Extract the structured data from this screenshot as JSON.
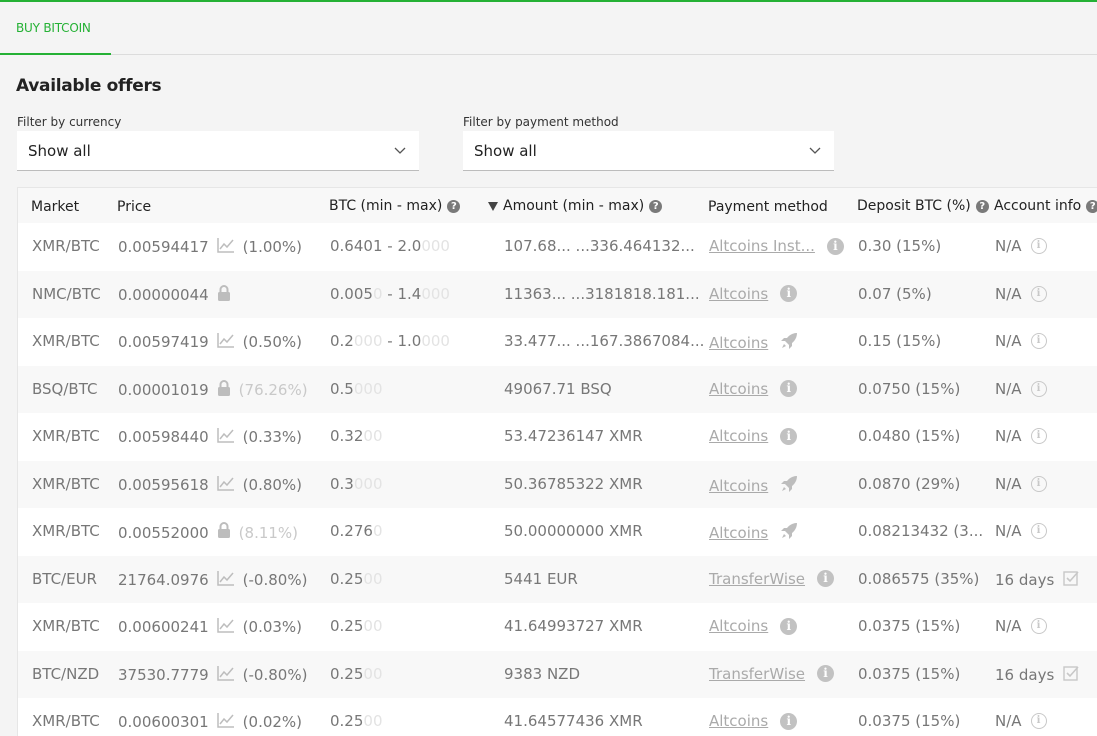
{
  "tabs": [
    {
      "label": "BUY BITCOIN",
      "active": true
    }
  ],
  "heading": "Available offers",
  "filters": {
    "currency": {
      "label": "Filter by currency",
      "value": "Show all"
    },
    "payment": {
      "label": "Filter by payment method",
      "value": "Show all"
    }
  },
  "columns": {
    "market": "Market",
    "price": "Price",
    "btc": "BTC (min - max)",
    "amount": "Amount (min - max)",
    "payment": "Payment method",
    "deposit": "Deposit BTC (%)",
    "account": "Account info"
  },
  "rows": [
    {
      "market": "XMR/BTC",
      "price": "0.00594417",
      "price_icon": "chart-icon",
      "pct": "(1.00%)",
      "pct_light": false,
      "btc_a": "0.6401",
      "btc_sep": " - ",
      "btc_b": "2.0",
      "btc_b_faint": "000",
      "amount": "107.68... ...336.464132...",
      "pay": "Altcoins Inst...",
      "pay_icon": "info-icon",
      "deposit": "0.30 (15%)",
      "account": "N/A",
      "account_icon": "info-circle-icon"
    },
    {
      "market": "NMC/BTC",
      "price": "0.00000044",
      "price_icon": "lock-icon",
      "pct": "",
      "pct_light": false,
      "btc_a": "0.005",
      "btc_a_faint": "0",
      "btc_sep": " - ",
      "btc_b": "1.4",
      "btc_b_faint": "000",
      "amount": "11363... ...3181818.181...",
      "pay": "Altcoins",
      "pay_icon": "info-icon",
      "deposit": "0.07 (5%)",
      "account": "N/A",
      "account_icon": "info-circle-icon"
    },
    {
      "market": "XMR/BTC",
      "price": "0.00597419",
      "price_icon": "chart-icon",
      "pct": "(0.50%)",
      "pct_light": false,
      "btc_a": "0.2",
      "btc_a_faint": "000",
      "btc_sep": " - ",
      "btc_b": "1.0",
      "btc_b_faint": "000",
      "amount": "33.477... ...167.3867084...",
      "pay": "Altcoins",
      "pay_icon": "rocket-icon",
      "deposit": "0.15 (15%)",
      "account": "N/A",
      "account_icon": "info-circle-icon"
    },
    {
      "market": "BSQ/BTC",
      "price": "0.00001019",
      "price_icon": "lock-icon",
      "pct": "(76.26%)",
      "pct_light": true,
      "btc_a": "0.5",
      "btc_a_faint": "000",
      "amount": "49067.71 BSQ",
      "pay": "Altcoins",
      "pay_icon": "info-icon",
      "deposit": "0.0750 (15%)",
      "account": "N/A",
      "account_icon": "info-circle-icon"
    },
    {
      "market": "XMR/BTC",
      "price": "0.00598440",
      "price_icon": "chart-icon",
      "pct": "(0.33%)",
      "pct_light": false,
      "btc_a": "0.32",
      "btc_a_faint": "00",
      "amount": "53.47236147 XMR",
      "pay": "Altcoins",
      "pay_icon": "info-icon",
      "deposit": "0.0480 (15%)",
      "account": "N/A",
      "account_icon": "info-circle-icon"
    },
    {
      "market": "XMR/BTC",
      "price": "0.00595618",
      "price_icon": "chart-icon",
      "pct": "(0.80%)",
      "pct_light": false,
      "btc_a": "0.3",
      "btc_a_faint": "000",
      "amount": "50.36785322 XMR",
      "pay": "Altcoins",
      "pay_icon": "rocket-icon",
      "deposit": "0.0870 (29%)",
      "account": "N/A",
      "account_icon": "info-circle-icon"
    },
    {
      "market": "XMR/BTC",
      "price": "0.00552000",
      "price_icon": "lock-icon",
      "pct": "(8.11%)",
      "pct_light": true,
      "btc_a": "0.276",
      "btc_a_faint": "0",
      "amount": "50.00000000 XMR",
      "pay": "Altcoins",
      "pay_icon": "rocket-icon",
      "deposit": "0.08213432 (3...",
      "account": "N/A",
      "account_icon": "info-circle-icon"
    },
    {
      "market": "BTC/EUR",
      "price": "21764.0976",
      "price_icon": "chart-icon",
      "pct": "(-0.80%)",
      "pct_light": false,
      "btc_a": "0.25",
      "btc_a_faint": "00",
      "amount": "5441 EUR",
      "pay": "TransferWise",
      "pay_icon": "info-icon",
      "deposit": "0.086575 (35%)",
      "account": "16 days",
      "account_icon": "checkbox-icon"
    },
    {
      "market": "XMR/BTC",
      "price": "0.00600241",
      "price_icon": "chart-icon",
      "pct": "(0.03%)",
      "pct_light": false,
      "btc_a": "0.25",
      "btc_a_faint": "00",
      "amount": "41.64993727 XMR",
      "pay": "Altcoins",
      "pay_icon": "info-icon",
      "deposit": "0.0375 (15%)",
      "account": "N/A",
      "account_icon": "info-circle-icon"
    },
    {
      "market": "BTC/NZD",
      "price": "37530.7779",
      "price_icon": "chart-icon",
      "pct": "(-0.80%)",
      "pct_light": false,
      "btc_a": "0.25",
      "btc_a_faint": "00",
      "amount": "9383 NZD",
      "pay": "TransferWise",
      "pay_icon": "info-icon",
      "deposit": "0.0375 (15%)",
      "account": "16 days",
      "account_icon": "checkbox-icon"
    },
    {
      "market": "XMR/BTC",
      "price": "0.00600301",
      "price_icon": "chart-icon",
      "pct": "(0.02%)",
      "pct_light": false,
      "btc_a": "0.25",
      "btc_a_faint": "00",
      "amount": "41.64577436 XMR",
      "pay": "Altcoins",
      "pay_icon": "info-icon",
      "deposit": "0.0375 (15%)",
      "account": "N/A",
      "account_icon": "info-circle-icon"
    }
  ]
}
